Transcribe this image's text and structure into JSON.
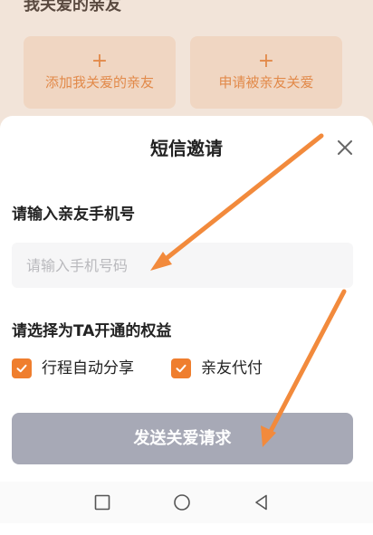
{
  "background": {
    "title": "我关爱的亲友",
    "cards": [
      {
        "plus": "+",
        "label": "添加我关爱的亲友"
      },
      {
        "plus": "+",
        "label": "申请被亲友关爱"
      }
    ]
  },
  "sheet": {
    "title": "短信邀请",
    "phone_label": "请输入亲友手机号",
    "phone_input": {
      "value": "",
      "placeholder": "请输入手机号码"
    },
    "rights_label": "请选择为TA开通的权益",
    "options": [
      {
        "label": "行程自动分享",
        "checked": true
      },
      {
        "label": "亲友代付",
        "checked": true
      }
    ],
    "send_button": "发送关爱请求"
  },
  "colors": {
    "accent": "#ef7e2e",
    "button_disabled": "#a7a9b6",
    "annotation_arrow": "#f28a3c"
  },
  "icons": {
    "close": "close-icon",
    "check": "checkmark-icon",
    "nav_recent": "square-icon",
    "nav_home": "circle-icon",
    "nav_back": "triangle-back-icon"
  }
}
